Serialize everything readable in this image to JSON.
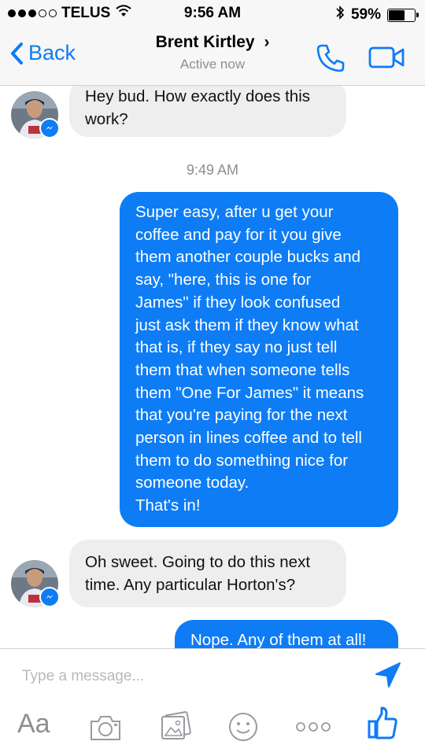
{
  "status_bar": {
    "carrier": "TELUS",
    "time": "9:56 AM",
    "battery": "59%",
    "battery_level": 0.59
  },
  "header": {
    "back_label": "Back",
    "contact_name": "Brent Kirtley",
    "contact_chevron": "›",
    "presence": "Active now",
    "icons": [
      "phone-icon",
      "video-camera-icon"
    ]
  },
  "conversation": {
    "messages": [
      {
        "direction": "incoming",
        "lines": [
          "Hey bud. How exactly does this",
          "work?"
        ]
      },
      {
        "timestamp": "9:49 AM"
      },
      {
        "direction": "outgoing",
        "lines": [
          "Super easy, after u get your",
          "coffee and pay for it you give",
          "them another couple bucks and",
          "say, \"here, this is one for",
          "James\" if they look confused",
          "just ask them if they know what",
          "that is, if they say no just tell",
          "them that when someone tells",
          "them \"One For James\" it means",
          "that you're paying for the next",
          "person in lines coffee and to tell",
          "them to do something nice for",
          "someone today.",
          "That's in!"
        ]
      },
      {
        "direction": "incoming",
        "lines": [
          "Oh sweet. Going to do this next",
          "time. Any particular Horton's?"
        ]
      },
      {
        "direction": "outgoing",
        "lines": [
          "Nope. Any of them at all!"
        ]
      }
    ]
  },
  "composer": {
    "placeholder": "Type a message...",
    "text_format_label": "Aa",
    "toolbar_icons": [
      "camera-icon",
      "photos-icon",
      "emoji-icon",
      "more-icon",
      "like-icon"
    ]
  },
  "colors": {
    "accent": "#0e7cf5",
    "incoming_bubble": "#eeeeee",
    "secondary_text": "#8e8e93"
  }
}
